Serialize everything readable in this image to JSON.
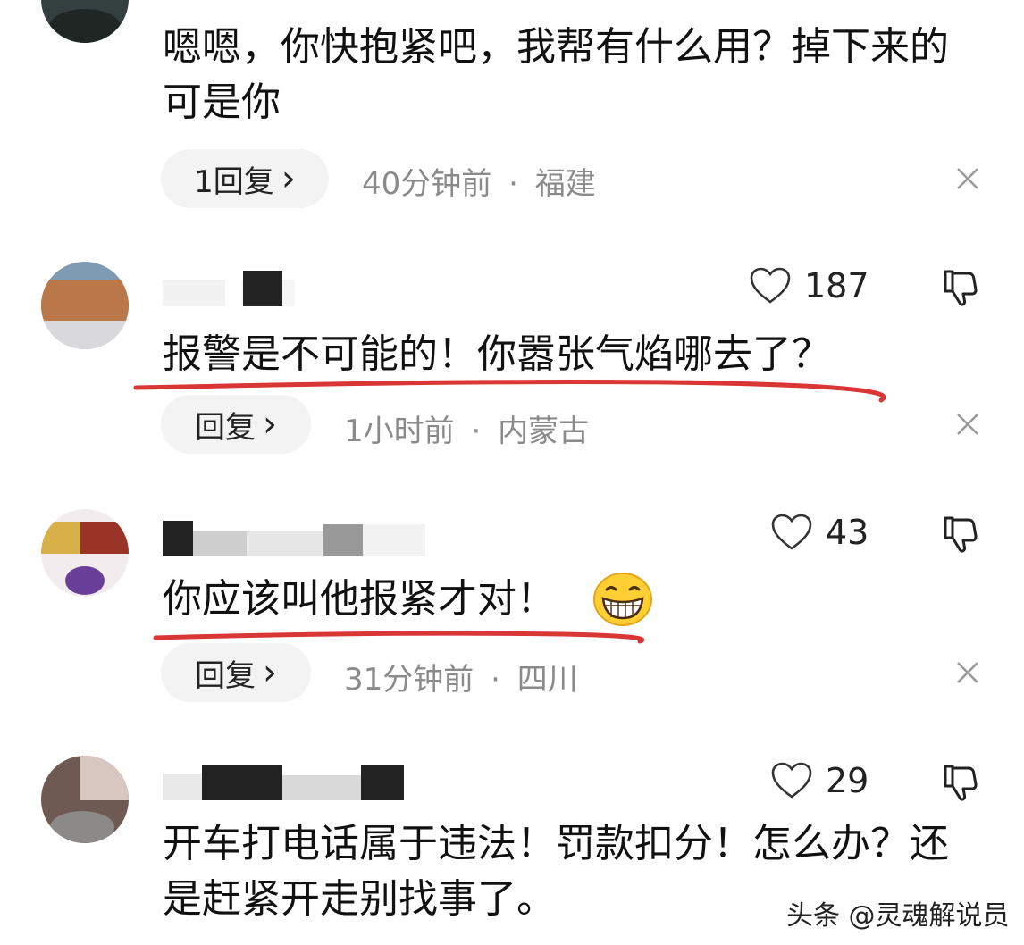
{
  "comments": [
    {
      "text": "嗯嗯，你快抱紧吧，我帮有什么用？掉下来的可是你",
      "reply_label": "1回复",
      "time": "40分钟前",
      "location": "福建"
    },
    {
      "likes": "187",
      "text": "报警是不可能的！你嚣张气焰哪去了？",
      "reply_label": "回复",
      "time": "1小时前",
      "location": "内蒙古"
    },
    {
      "likes": "43",
      "text": "你应该叫他报紧才对！",
      "emoji": "grinning-face",
      "reply_label": "回复",
      "time": "31分钟前",
      "location": "四川"
    },
    {
      "likes": "29",
      "text": "开车打电话属于违法！罚款扣分！怎么办？还是赶紧开走别找事了。"
    }
  ],
  "separator": "·",
  "reply_chevron": "›",
  "watermark": "头条 @灵魂解说员",
  "colors": {
    "underline": "#d93636",
    "meta": "#8a8a8a",
    "reply_bg": "#f3f3f3"
  }
}
